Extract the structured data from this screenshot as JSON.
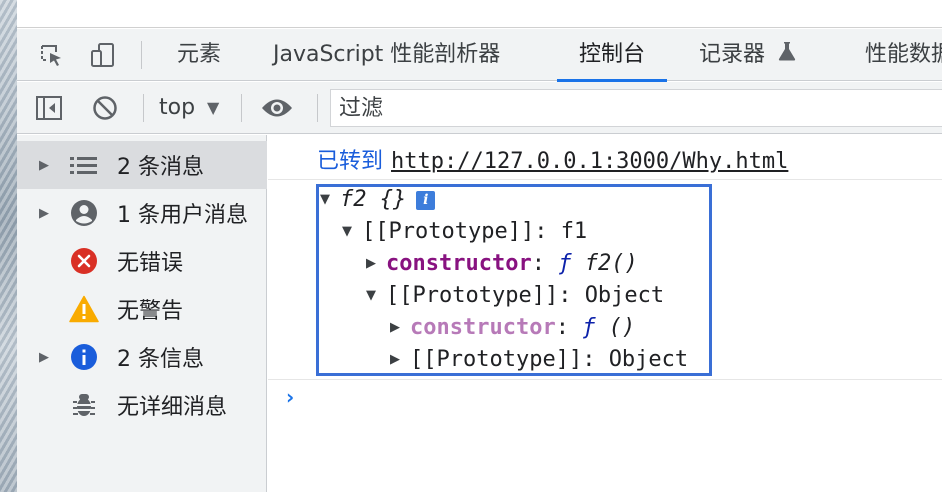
{
  "tabs": {
    "elements": "元素",
    "profiler": "JavaScript 性能剖析器",
    "console": "控制台",
    "recorder": "记录器",
    "performance": "性能数据"
  },
  "toolbar": {
    "context": "top",
    "filter_placeholder": "过滤"
  },
  "sidebar": {
    "items": [
      {
        "label": "2 条消息",
        "icon": "list-icon",
        "expandable": true,
        "selected": true
      },
      {
        "label": "1 条用户消息",
        "icon": "user-icon",
        "expandable": true
      },
      {
        "label": "无错误",
        "icon": "error-icon",
        "expandable": false
      },
      {
        "label": "无警告",
        "icon": "warning-icon",
        "expandable": false
      },
      {
        "label": "2 条信息",
        "icon": "info-icon",
        "expandable": true
      },
      {
        "label": "无详细消息",
        "icon": "bug-icon",
        "expandable": false
      }
    ]
  },
  "console": {
    "nav_label": "已转到",
    "nav_url": "http://127.0.0.1:3000/Why.html",
    "object": {
      "root": "f2 {}",
      "proto_key": "[[Prototype]]",
      "colon": ":",
      "proto1_value": "f1",
      "ctor_key": "constructor",
      "fn_symbol": "ƒ",
      "ctor1_value": "f2()",
      "proto2_value": "Object",
      "ctor2_value": "()",
      "proto3_value": "Object"
    },
    "prompt": "›"
  },
  "colors": {
    "accent": "#1a73e8",
    "highlight_box": "#3a6fd6",
    "constructor_key": "#881280",
    "error": "#d93025",
    "warning": "#f9ab00",
    "info": "#1a5ddb"
  }
}
